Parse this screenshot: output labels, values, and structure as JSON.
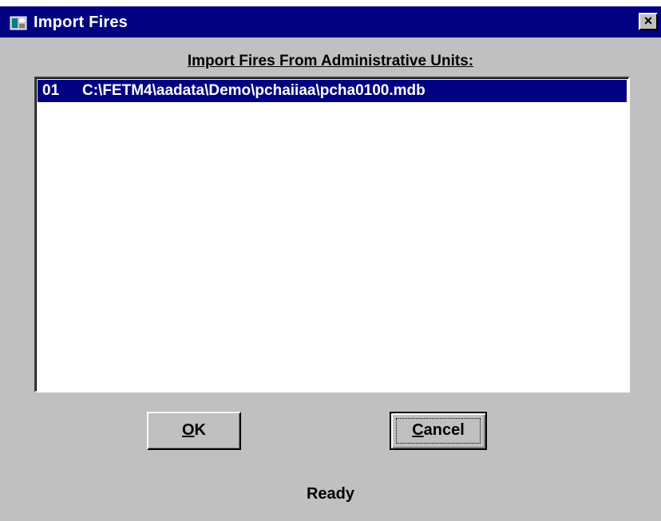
{
  "window": {
    "title": "Import Fires",
    "close_label": "×"
  },
  "list": {
    "label": "Import Fires From Administrative Units:",
    "items": [
      {
        "number": "01",
        "path": "C:\\FETM4\\aadata\\Demo\\pchaiiaa\\pcha0100.mdb",
        "selected": true
      }
    ]
  },
  "buttons": {
    "ok_mnemonic": "O",
    "ok_rest": "K",
    "cancel_mnemonic": "C",
    "cancel_rest": "ancel"
  },
  "status": {
    "text": "Ready"
  },
  "colors": {
    "titlebar": "#000080",
    "face": "#c0c0c0",
    "selection": "#000080"
  }
}
